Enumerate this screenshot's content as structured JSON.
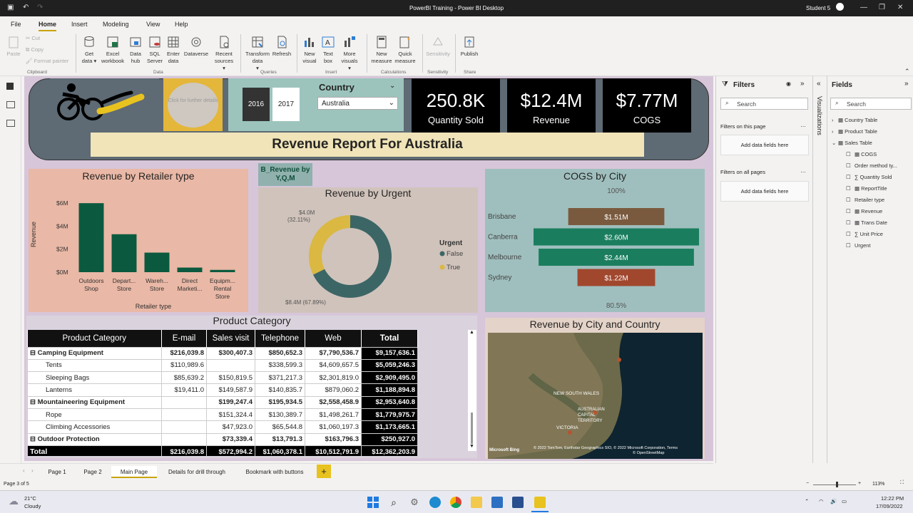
{
  "window": {
    "title": "PowerBI Training - Power BI Desktop",
    "user": "Student 5"
  },
  "menu_tabs": [
    "File",
    "Home",
    "Insert",
    "Modeling",
    "View",
    "Help"
  ],
  "ribbon": {
    "clipboard": {
      "paste": "Paste",
      "cut": "Cut",
      "copy": "Copy",
      "format_painter": "Format painter",
      "group": "Clipboard"
    },
    "data": {
      "get_data": "Get data",
      "excel": "Excel workbook",
      "data_hub": "Data hub",
      "sql": "SQL Server",
      "enter": "Enter data",
      "dataverse": "Dataverse",
      "recent": "Recent sources",
      "group": "Data"
    },
    "queries": {
      "transform": "Transform data",
      "refresh": "Refresh",
      "group": "Queries"
    },
    "insert": {
      "new_visual": "New visual",
      "text_box": "Text box",
      "more_visuals": "More visuals",
      "group": "Insert"
    },
    "calculations": {
      "new_measure": "New measure",
      "quick_measure": "Quick measure",
      "group": "Calculations"
    },
    "sensitivity": {
      "label": "Sensitivity",
      "group": "Sensitivity"
    },
    "share": {
      "publish": "Publish",
      "group": "Share"
    }
  },
  "header": {
    "image_placeholder": "Click for further details",
    "years": [
      "2016",
      "2017"
    ],
    "country_label": "Country",
    "country_value": "Australia",
    "kpis": [
      {
        "value": "250.8K",
        "label": "Quantity Sold"
      },
      {
        "value": "$12.4M",
        "label": "Revenue"
      },
      {
        "value": "$7.77M",
        "label": "COGS"
      }
    ],
    "report_title": "Revenue Report For Australia"
  },
  "bookmark_button": "B_Revenue by Y,Q,M",
  "chart_data": [
    {
      "type": "bar",
      "title": "Revenue by Retailer type",
      "xlabel": "Retailer type",
      "ylabel": "Revenue",
      "categories": [
        "Outdoors Shop",
        "Depart... Store",
        "Wareh... Store",
        "Direct Marketi...",
        "Equipm... Rental Store"
      ],
      "category_lines": [
        [
          "Outdoors",
          "Shop"
        ],
        [
          "Depart...",
          "Store"
        ],
        [
          "Wareh...",
          "Store"
        ],
        [
          "Direct",
          "Marketi..."
        ],
        [
          "Equipm...",
          "Rental",
          "Store"
        ]
      ],
      "values": [
        6.0,
        3.3,
        1.7,
        0.4,
        0.2
      ],
      "yticks": [
        "$0M",
        "$2M",
        "$4M",
        "$6M"
      ],
      "ylim": [
        0,
        7
      ],
      "color": "#0b5a3f"
    },
    {
      "type": "pie",
      "title": "Revenue by Urgent",
      "legend_title": "Urgent",
      "series": [
        {
          "name": "False",
          "value": 8.4,
          "label": "$8.4M (67.89%)",
          "color": "#3c6666"
        },
        {
          "name": "True",
          "value": 4.0,
          "label": "$4.0M (32.11%)",
          "color": "#dab842"
        }
      ]
    },
    {
      "type": "bar",
      "title": "COGS by City",
      "top_label": "100%",
      "bottom_label": "80.5%",
      "categories": [
        "Brisbane",
        "Canberra",
        "Melbourne",
        "Sydney"
      ],
      "values": [
        1.51,
        2.6,
        2.44,
        1.22
      ],
      "labels": [
        "$1.51M",
        "$2.60M",
        "$2.44M",
        "$1.22M"
      ],
      "colors": [
        "#7a5a3e",
        "#1a7e5e",
        "#1a7e5e",
        "#a0472d"
      ]
    }
  ],
  "product_table": {
    "title": "Product Category",
    "columns": [
      "Product Category",
      "E-mail",
      "Sales visit",
      "Telephone",
      "Web",
      "Total"
    ],
    "rows": [
      {
        "name": "Camping Equipment",
        "cat": true,
        "v": [
          "$216,039.8",
          "$300,407.3",
          "$850,652.3",
          "$7,790,536.7",
          "$9,157,636.1"
        ]
      },
      {
        "name": "Tents",
        "cat": false,
        "v": [
          "$110,989.6",
          "",
          "$338,599.3",
          "$4,609,657.5",
          "$5,059,246.3"
        ]
      },
      {
        "name": "Sleeping Bags",
        "cat": false,
        "v": [
          "$85,639.2",
          "$150,819.5",
          "$371,217.3",
          "$2,301,819.0",
          "$2,909,495.0"
        ]
      },
      {
        "name": "Lanterns",
        "cat": false,
        "v": [
          "$19,411.0",
          "$149,587.9",
          "$140,835.7",
          "$879,060.2",
          "$1,188,894.8"
        ]
      },
      {
        "name": "Mountaineering Equipment",
        "cat": true,
        "v": [
          "",
          "$199,247.4",
          "$195,934.5",
          "$2,558,458.9",
          "$2,953,640.8"
        ]
      },
      {
        "name": "Rope",
        "cat": false,
        "v": [
          "",
          "$151,324.4",
          "$130,389.7",
          "$1,498,261.7",
          "$1,779,975.7"
        ]
      },
      {
        "name": "Climbing Accessories",
        "cat": false,
        "v": [
          "",
          "$47,923.0",
          "$65,544.8",
          "$1,060,197.3",
          "$1,173,665.1"
        ]
      },
      {
        "name": "Outdoor Protection",
        "cat": true,
        "v": [
          "",
          "$73,339.4",
          "$13,791.3",
          "$163,796.3",
          "$250,927.0"
        ]
      }
    ],
    "total": {
      "name": "Total",
      "v": [
        "$216,039.8",
        "$572,994.2",
        "$1,060,378.1",
        "$10,512,791.9",
        "$12,362,203.9"
      ]
    }
  },
  "map": {
    "title": "Revenue by City and Country",
    "labels": [
      "NEW SOUTH WALES",
      "AUSTRALIAN CAPITAL TERRITORY",
      "VICTORIA"
    ],
    "credit": "© 2022 TomTom, Earthstar Geographics SIO, © 2022 Microsoft Corporation, Terms",
    "osm": "© OpenStreetMap",
    "bing": "Microsoft Bing"
  },
  "filters": {
    "title": "Filters",
    "search": "Search",
    "on_page": "Filters on this page",
    "on_all": "Filters on all pages",
    "add": "Add data fields here"
  },
  "viz_label": "Visualizations",
  "fields": {
    "title": "Fields",
    "search": "Search",
    "tables": [
      "Country Table",
      "Product Table",
      "Sales Table"
    ],
    "sales_items": [
      "COGS",
      "Order method ty...",
      "Quantity Sold",
      "ReportTitle",
      "Retailer type",
      "Revenue",
      "Trans Date",
      "Unit Price",
      "Urgent"
    ]
  },
  "pages": [
    "Page 1",
    "Page 2",
    "Main Page",
    "Details for drill through",
    "Bookmark with buttons"
  ],
  "status": {
    "page": "Page 3 of 5",
    "zoom": "113%"
  },
  "taskbar": {
    "temp": "21°C",
    "weather": "Cloudy",
    "time": "12:22 PM",
    "date": "17/09/2022"
  }
}
